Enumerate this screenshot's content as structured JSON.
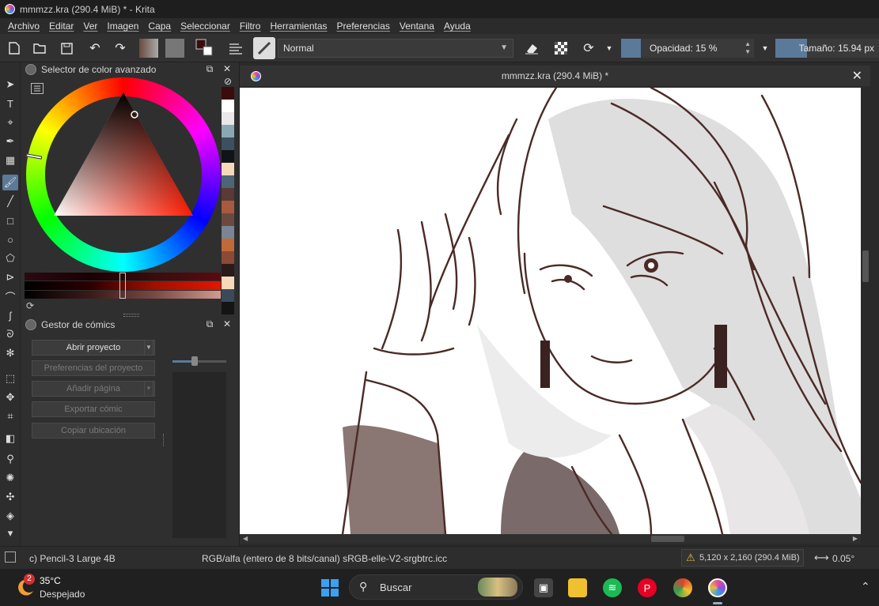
{
  "window": {
    "title": "mmmzz.kra (290.4 MiB) * - Krita"
  },
  "menu": [
    "Archivo",
    "Editar",
    "Ver",
    "Imagen",
    "Capa",
    "Seleccionar",
    "Filtro",
    "Herramientas",
    "Preferencias",
    "Ventana",
    "Ayuda"
  ],
  "toolbar": {
    "blend_mode": "Normal",
    "opacity_label": "Opacidad: 15 %",
    "opacity_value": 0.15,
    "size_label": "Tamaño: 15.94 px",
    "size_fill": 0.3
  },
  "color_selector": {
    "title": "Selector de color avanzado",
    "palette": [
      "#3a0c0c",
      "#ffffff",
      "#e8e8e8",
      "#8aa8b4",
      "#3c5062",
      "#101418",
      "#f6d9b8",
      "#4c6678",
      "#5a3a34",
      "#a85a3e",
      "#6a4a40",
      "#7a8494",
      "#c06a3a",
      "#8a4a36",
      "#2a1a1a",
      "#f6d9b8",
      "#3a4a5a",
      "#141414"
    ]
  },
  "comic_manager": {
    "title": "Gestor de cómics",
    "buttons": {
      "open_project": "Abrir proyecto",
      "project_prefs": "Preferencias del proyecto",
      "add_page": "Añadir página",
      "export": "Exportar cómic",
      "copy_location": "Copiar ubicación"
    }
  },
  "document": {
    "tab_title": "mmmzz.kra (290.4 MiB) *"
  },
  "status": {
    "brush": "c) Pencil-3 Large 4B",
    "color_space": "RGB/alfa (entero de 8 bits/canal)  sRGB-elle-V2-srgbtrc.icc",
    "dimensions": "5,120 x 2,160 (290.4 MiB)",
    "rotation": "0.05°"
  },
  "taskbar": {
    "weather_temp": "35°C",
    "weather_desc": "Despejado",
    "weather_badge": "2",
    "search_label": "Buscar"
  },
  "colors": {
    "accent": "#5b7a99",
    "ink": "#4a2a26"
  }
}
